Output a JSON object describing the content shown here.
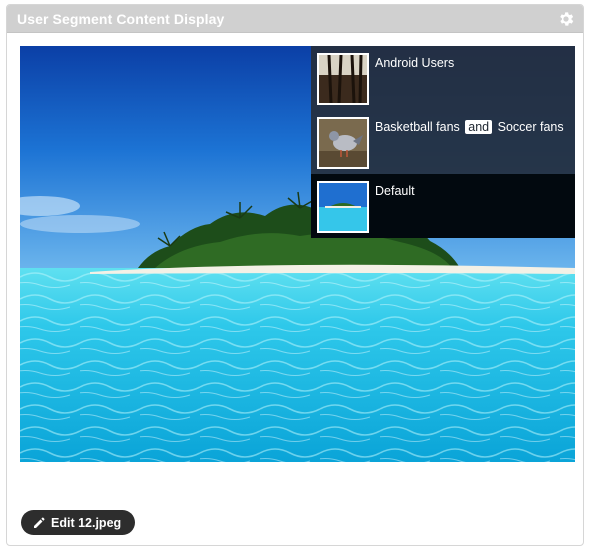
{
  "portlet": {
    "title": "User Segment Content Display",
    "settings_icon": "gear-icon"
  },
  "segments": [
    {
      "label": "Android Users",
      "thumbnail": "forest-thumbnail",
      "active": false
    },
    {
      "label_before": "Basketball fans",
      "label_and": "and",
      "label_after": "Soccer fans",
      "thumbnail": "pigeon-thumbnail",
      "active": false
    },
    {
      "label": "Default",
      "thumbnail": "beach-thumbnail",
      "active": true
    }
  ],
  "edit_button": {
    "icon": "pencil-icon",
    "label": "Edit 12.jpeg"
  },
  "colors": {
    "header_bg": "#d0d0d0",
    "overlay_bg": "#262e3a",
    "active_row_bg": "#02090f",
    "button_bg": "#2d2d2d"
  }
}
